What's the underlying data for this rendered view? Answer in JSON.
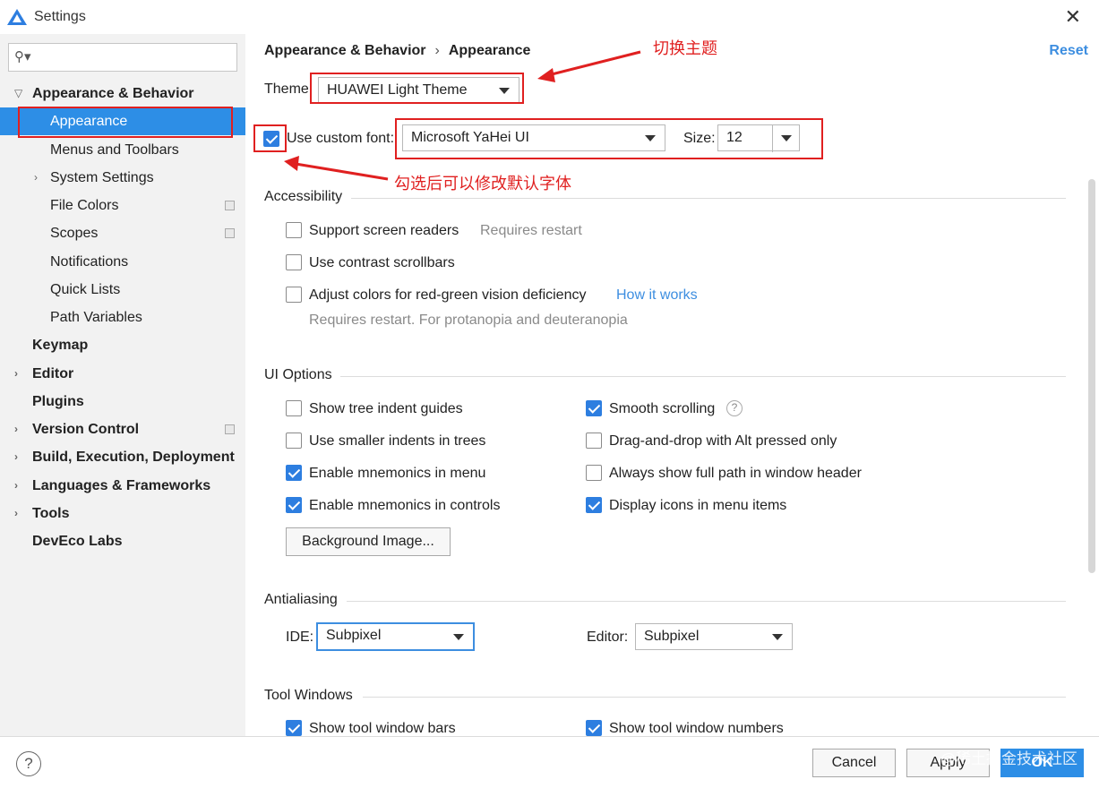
{
  "window": {
    "title": "Settings"
  },
  "sidebar": {
    "search_placeholder": "",
    "items": [
      {
        "label": "Appearance & Behavior",
        "level": 0,
        "expanded": true
      },
      {
        "label": "Appearance",
        "level": 1,
        "selected": true
      },
      {
        "label": "Menus and Toolbars",
        "level": 1
      },
      {
        "label": "System Settings",
        "level": 1,
        "collapsed": true
      },
      {
        "label": "File Colors",
        "level": 1
      },
      {
        "label": "Scopes",
        "level": 1
      },
      {
        "label": "Notifications",
        "level": 1
      },
      {
        "label": "Quick Lists",
        "level": 1
      },
      {
        "label": "Path Variables",
        "level": 1
      },
      {
        "label": "Keymap",
        "level": 0
      },
      {
        "label": "Editor",
        "level": 0
      },
      {
        "label": "Plugins",
        "level": 0
      },
      {
        "label": "Version Control",
        "level": 0
      },
      {
        "label": "Build, Execution, Deployment",
        "level": 0
      },
      {
        "label": "Languages & Frameworks",
        "level": 0
      },
      {
        "label": "Tools",
        "level": 0
      },
      {
        "label": "DevEco Labs",
        "level": 0
      }
    ]
  },
  "header": {
    "breadcrumb": [
      "Appearance & Behavior",
      "Appearance"
    ],
    "reset_label": "Reset"
  },
  "theme": {
    "label": "Theme",
    "value": "HUAWEI Light Theme"
  },
  "font": {
    "label": "Use custom font:",
    "checked": true,
    "value": "Microsoft YaHei UI",
    "size_label": "Size:",
    "size_value": "12"
  },
  "accessibility": {
    "title": "Accessibility",
    "screen_readers": "Support screen readers",
    "screen_readers_hint": "Requires restart",
    "contrast_scrollbars": "Use contrast scrollbars",
    "color_deficiency": "Adjust colors for red-green vision deficiency",
    "how_it_works": "How it works",
    "color_deficiency_hint": "Requires restart. For protanopia and deuteranopia"
  },
  "ui_options": {
    "title": "UI Options",
    "tree_indent": "Show tree indent guides",
    "smaller_indents": "Use smaller indents in trees",
    "mnemonics_menu": "Enable mnemonics in menu",
    "mnemonics_controls": "Enable mnemonics in controls",
    "smooth_scrolling": "Smooth scrolling",
    "drag_drop": "Drag-and-drop with Alt pressed only",
    "full_path": "Always show full path in window header",
    "menu_icons": "Display icons in menu items",
    "background_image": "Background Image..."
  },
  "antialiasing": {
    "title": "Antialiasing",
    "ide_label": "IDE:",
    "ide_value": "Subpixel",
    "editor_label": "Editor:",
    "editor_value": "Subpixel"
  },
  "tool_windows": {
    "title": "Tool Windows",
    "show_bars": "Show tool window bars",
    "show_numbers": "Show tool window numbers"
  },
  "annotations": {
    "switch_theme": "切换主题",
    "font_hint": "勾选后可以修改默认字体"
  },
  "footer": {
    "help": "?",
    "cancel": "Cancel",
    "apply": "Apply",
    "ok": "OK",
    "watermark": "@稀土掘金技术社区"
  },
  "colors": {
    "accent": "#2d8ee6",
    "annotation": "#e02020",
    "link": "#3d8ee0"
  }
}
